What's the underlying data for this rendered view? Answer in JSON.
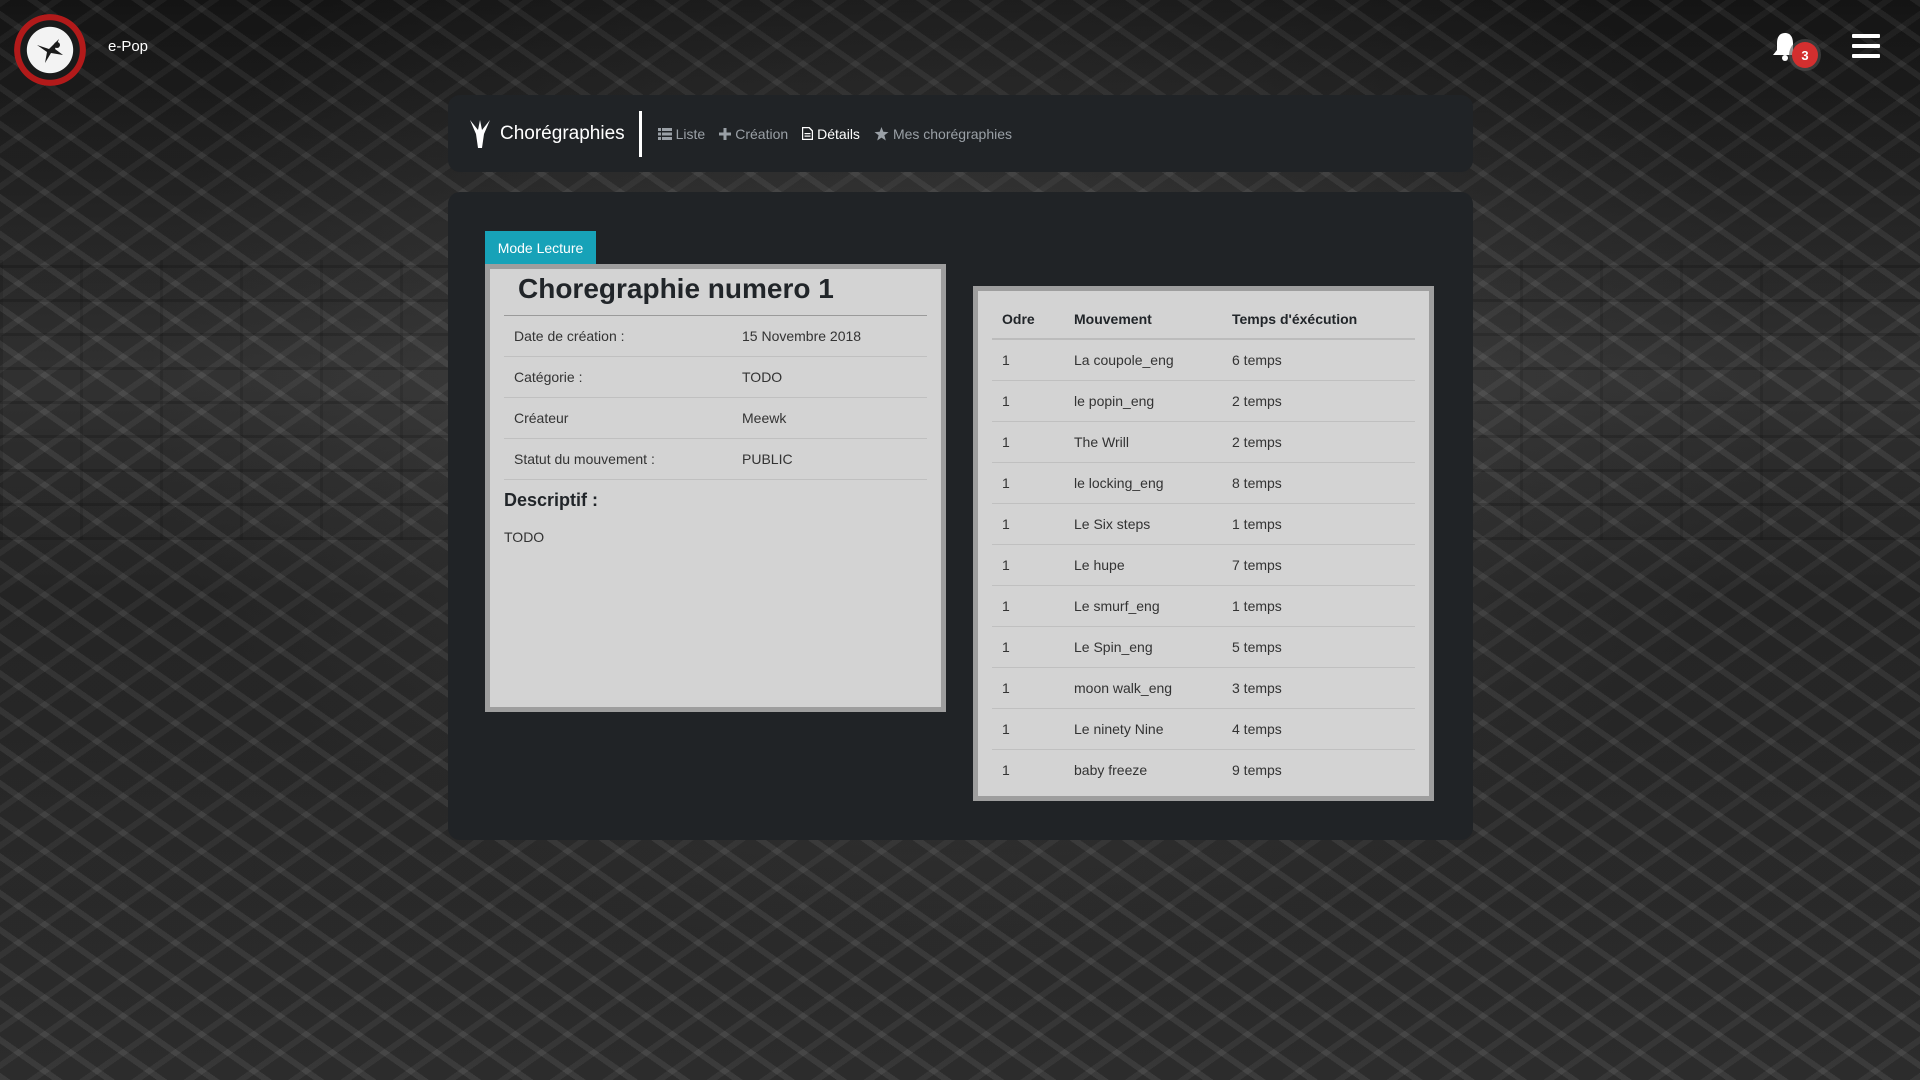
{
  "app": {
    "brand": "e-Pop",
    "notifications_count": "3"
  },
  "nav": {
    "title": "Chorégraphies",
    "links": [
      {
        "label": "Liste",
        "icon": "list-icon"
      },
      {
        "label": "Création",
        "icon": "plus-icon"
      },
      {
        "label": "Détails",
        "icon": "document-icon"
      },
      {
        "label": "Mes chorégraphies",
        "icon": "star-icon"
      }
    ],
    "active": "Détails"
  },
  "mode_button": "Mode Lecture",
  "info": {
    "title": "Choregraphie numero 1",
    "rows": [
      {
        "key": "Date de création :",
        "value": "15 Novembre 2018"
      },
      {
        "key": "Catégorie :",
        "value": "TODO"
      },
      {
        "key": "Créateur",
        "value": "Meewk"
      },
      {
        "key": "Statut du mouvement :",
        "value": "PUBLIC"
      }
    ],
    "desc_title": "Descriptif :",
    "desc_text": "TODO"
  },
  "moves_table": {
    "headers": [
      "Odre",
      "Mouvement",
      "Temps d'éxécution"
    ],
    "rows": [
      [
        "1",
        "La coupole_eng",
        "6 temps"
      ],
      [
        "1",
        "le popin_eng",
        "2 temps"
      ],
      [
        "1",
        "The Wrill",
        "2 temps"
      ],
      [
        "1",
        "le locking_eng",
        "8 temps"
      ],
      [
        "1",
        "Le Six steps",
        "1 temps"
      ],
      [
        "1",
        "Le hupe",
        "7 temps"
      ],
      [
        "1",
        "Le smurf_eng",
        "1 temps"
      ],
      [
        "1",
        "Le Spin_eng",
        "5 temps"
      ],
      [
        "1",
        "moon walk_eng",
        "3 temps"
      ],
      [
        "1",
        "Le ninety Nine",
        "4 temps"
      ],
      [
        "1",
        "baby freeze",
        "9 temps"
      ]
    ]
  },
  "colors": {
    "accent": "#17a2b8",
    "badge": "#d32f2f",
    "panel": "#202326",
    "card": "#d3d3d3"
  }
}
